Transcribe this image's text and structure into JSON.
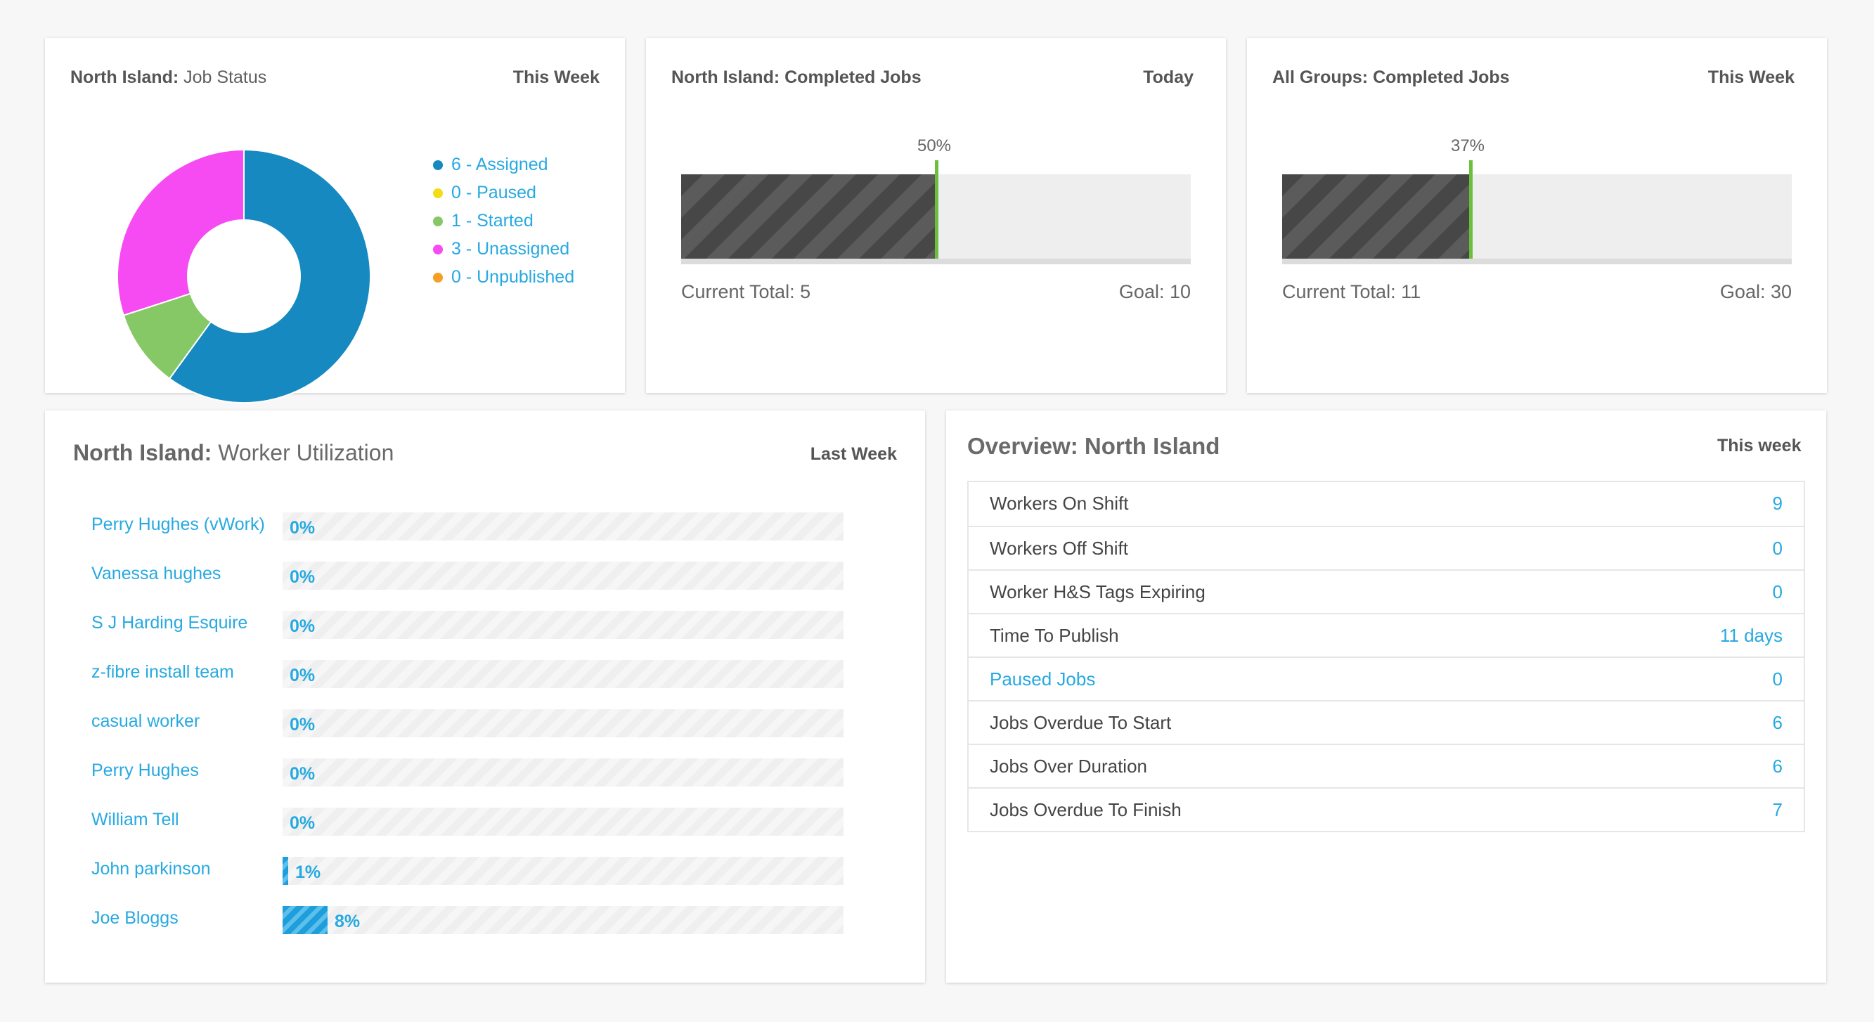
{
  "job_status": {
    "region": "North Island:",
    "title": "Job Status",
    "period": "This Week",
    "chart_data": {
      "type": "pie",
      "categories": [
        "Assigned",
        "Paused",
        "Started",
        "Unassigned",
        "Unpublished"
      ],
      "values": [
        6,
        0,
        1,
        3,
        0
      ],
      "colors": [
        "#1589c0",
        "#f2dd1a",
        "#86c865",
        "#f64af3",
        "#f5a024"
      ]
    },
    "legend": [
      {
        "label": "6 - Assigned",
        "color": "#1589c0"
      },
      {
        "label": "0 - Paused",
        "color": "#f2dd1a"
      },
      {
        "label": "1 - Started",
        "color": "#86c865"
      },
      {
        "label": "3 - Unassigned",
        "color": "#f64af3"
      },
      {
        "label": "0 - Unpublished",
        "color": "#f5a024"
      }
    ]
  },
  "completed_today": {
    "region": "North Island:",
    "title": "Completed Jobs",
    "period": "Today",
    "percent_label": "50%",
    "progress": 0.5,
    "current_label": "Current Total: 5",
    "goal_label": "Goal: 10"
  },
  "completed_week": {
    "region": "All Groups:",
    "title": "Completed Jobs",
    "period": "This Week",
    "percent_label": "37%",
    "progress": 0.37,
    "current_label": "Current Total: 11",
    "goal_label": "Goal: 30"
  },
  "utilization": {
    "region": "North Island:",
    "title": "Worker Utilization",
    "period": "Last Week",
    "workers": [
      {
        "name": "Perry Hughes (vWork)",
        "value": "0%",
        "pct": 0
      },
      {
        "name": "Vanessa hughes",
        "value": "0%",
        "pct": 0
      },
      {
        "name": "S J Harding Esquire",
        "value": "0%",
        "pct": 0
      },
      {
        "name": "z-fibre install team",
        "value": "0%",
        "pct": 0
      },
      {
        "name": "casual worker",
        "value": "0%",
        "pct": 0
      },
      {
        "name": "Perry Hughes",
        "value": "0%",
        "pct": 0
      },
      {
        "name": "William Tell",
        "value": "0%",
        "pct": 0
      },
      {
        "name": "John parkinson",
        "value": "1%",
        "pct": 1
      },
      {
        "name": "Joe Bloggs",
        "value": "8%",
        "pct": 8
      }
    ]
  },
  "overview": {
    "title": "Overview: North Island",
    "period": "This week",
    "rows": [
      {
        "label": "Workers On Shift",
        "value": "9",
        "link": false
      },
      {
        "label": "Workers Off Shift",
        "value": "0",
        "link": false
      },
      {
        "label": "Worker H&S Tags Expiring",
        "value": "0",
        "link": false
      },
      {
        "label": "Time To Publish",
        "value": "11 days",
        "link": false
      },
      {
        "label": "Paused Jobs",
        "value": "0",
        "link": true
      },
      {
        "label": "Jobs Overdue To Start",
        "value": "6",
        "link": false
      },
      {
        "label": "Jobs Over Duration",
        "value": "6",
        "link": false
      },
      {
        "label": "Jobs Overdue To Finish",
        "value": "7",
        "link": false
      }
    ]
  }
}
